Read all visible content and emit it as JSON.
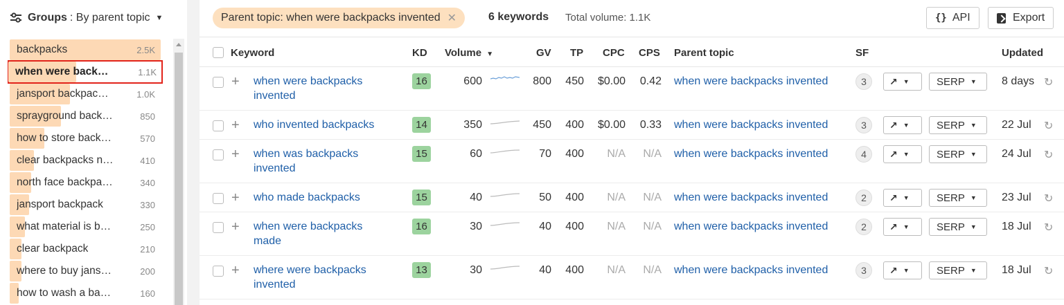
{
  "sidebar": {
    "groups_label": "Groups",
    "groups_value": ": By parent topic",
    "items": [
      {
        "label": "backpacks",
        "volume": "2.5K",
        "bar": 1.0,
        "selected": false
      },
      {
        "label": "when were back…",
        "volume": "1.1K",
        "bar": 0.44,
        "selected": true
      },
      {
        "label": "jansport backpac…",
        "volume": "1.0K",
        "bar": 0.4,
        "selected": false
      },
      {
        "label": "sprayground back…",
        "volume": "850",
        "bar": 0.34,
        "selected": false
      },
      {
        "label": "how to store back…",
        "volume": "570",
        "bar": 0.23,
        "selected": false
      },
      {
        "label": "clear backpacks n…",
        "volume": "410",
        "bar": 0.16,
        "selected": false
      },
      {
        "label": "north face backpa…",
        "volume": "340",
        "bar": 0.14,
        "selected": false
      },
      {
        "label": "jansport backpack",
        "volume": "330",
        "bar": 0.13,
        "selected": false
      },
      {
        "label": "what material is b…",
        "volume": "250",
        "bar": 0.1,
        "selected": false
      },
      {
        "label": "clear backpack",
        "volume": "210",
        "bar": 0.08,
        "selected": false
      },
      {
        "label": "where to buy jans…",
        "volume": "200",
        "bar": 0.08,
        "selected": false
      },
      {
        "label": "how to wash a ba…",
        "volume": "160",
        "bar": 0.06,
        "selected": false
      }
    ]
  },
  "topbar": {
    "filter_chip": "Parent topic: when were backpacks invented",
    "keyword_count": "6 keywords",
    "total_volume": "Total volume: 1.1K",
    "api_label": "API",
    "api_icon": "{}",
    "export_label": "Export"
  },
  "table": {
    "headers": {
      "keyword": "Keyword",
      "kd": "KD",
      "volume": "Volume",
      "gv": "GV",
      "tp": "TP",
      "cpc": "CPC",
      "cps": "CPS",
      "parent_topic": "Parent topic",
      "sf": "SF",
      "updated": "Updated"
    },
    "rows": [
      {
        "keyword": "when were backpacks invented",
        "kd": "16",
        "volume": "600",
        "gv": "800",
        "tp": "450",
        "cpc": "$0.00",
        "cps": "0.42",
        "parent_topic": "when were backpacks invented",
        "sf": "3",
        "serp": "SERP",
        "updated": "8 days"
      },
      {
        "keyword": "who invented backpacks",
        "kd": "14",
        "volume": "350",
        "gv": "450",
        "tp": "400",
        "cpc": "$0.00",
        "cps": "0.33",
        "parent_topic": "when were backpacks invented",
        "sf": "3",
        "serp": "SERP",
        "updated": "22 Jul"
      },
      {
        "keyword": "when was backpacks invented",
        "kd": "15",
        "volume": "60",
        "gv": "70",
        "tp": "400",
        "cpc": "N/A",
        "cps": "N/A",
        "parent_topic": "when were backpacks invented",
        "sf": "4",
        "serp": "SERP",
        "updated": "24 Jul"
      },
      {
        "keyword": "who made backpacks",
        "kd": "15",
        "volume": "40",
        "gv": "50",
        "tp": "400",
        "cpc": "N/A",
        "cps": "N/A",
        "parent_topic": "when were backpacks invented",
        "sf": "2",
        "serp": "SERP",
        "updated": "23 Jul"
      },
      {
        "keyword": "when were backpacks made",
        "kd": "16",
        "volume": "30",
        "gv": "40",
        "tp": "400",
        "cpc": "N/A",
        "cps": "N/A",
        "parent_topic": "when were backpacks invented",
        "sf": "2",
        "serp": "SERP",
        "updated": "18 Jul"
      },
      {
        "keyword": "where were backpacks invented",
        "kd": "13",
        "volume": "30",
        "gv": "40",
        "tp": "400",
        "cpc": "N/A",
        "cps": "N/A",
        "parent_topic": "when were backpacks invented",
        "sf": "3",
        "serp": "SERP",
        "updated": "18 Jul"
      }
    ]
  },
  "colors": {
    "accent_link": "#1f5fa8",
    "kd_green": "#9cd39e",
    "chip_orange": "#fde0bf",
    "bar_orange": "#fdd9b5",
    "selected_outline": "#e2231a"
  }
}
